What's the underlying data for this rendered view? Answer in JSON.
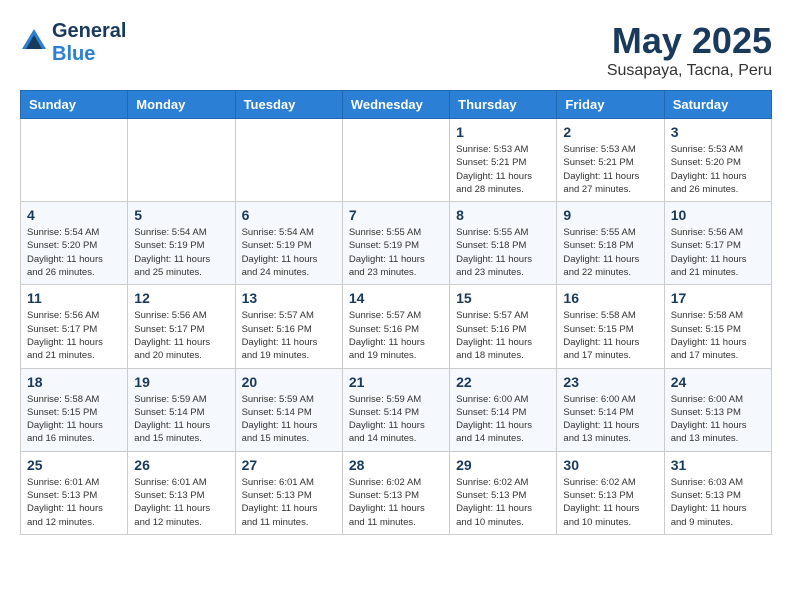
{
  "logo": {
    "general": "General",
    "blue": "Blue"
  },
  "title": {
    "month_year": "May 2025",
    "location": "Susapaya, Tacna, Peru"
  },
  "headers": [
    "Sunday",
    "Monday",
    "Tuesday",
    "Wednesday",
    "Thursday",
    "Friday",
    "Saturday"
  ],
  "weeks": [
    [
      {
        "day": "",
        "detail": ""
      },
      {
        "day": "",
        "detail": ""
      },
      {
        "day": "",
        "detail": ""
      },
      {
        "day": "",
        "detail": ""
      },
      {
        "day": "1",
        "detail": "Sunrise: 5:53 AM\nSunset: 5:21 PM\nDaylight: 11 hours\nand 28 minutes."
      },
      {
        "day": "2",
        "detail": "Sunrise: 5:53 AM\nSunset: 5:21 PM\nDaylight: 11 hours\nand 27 minutes."
      },
      {
        "day": "3",
        "detail": "Sunrise: 5:53 AM\nSunset: 5:20 PM\nDaylight: 11 hours\nand 26 minutes."
      }
    ],
    [
      {
        "day": "4",
        "detail": "Sunrise: 5:54 AM\nSunset: 5:20 PM\nDaylight: 11 hours\nand 26 minutes."
      },
      {
        "day": "5",
        "detail": "Sunrise: 5:54 AM\nSunset: 5:19 PM\nDaylight: 11 hours\nand 25 minutes."
      },
      {
        "day": "6",
        "detail": "Sunrise: 5:54 AM\nSunset: 5:19 PM\nDaylight: 11 hours\nand 24 minutes."
      },
      {
        "day": "7",
        "detail": "Sunrise: 5:55 AM\nSunset: 5:19 PM\nDaylight: 11 hours\nand 23 minutes."
      },
      {
        "day": "8",
        "detail": "Sunrise: 5:55 AM\nSunset: 5:18 PM\nDaylight: 11 hours\nand 23 minutes."
      },
      {
        "day": "9",
        "detail": "Sunrise: 5:55 AM\nSunset: 5:18 PM\nDaylight: 11 hours\nand 22 minutes."
      },
      {
        "day": "10",
        "detail": "Sunrise: 5:56 AM\nSunset: 5:17 PM\nDaylight: 11 hours\nand 21 minutes."
      }
    ],
    [
      {
        "day": "11",
        "detail": "Sunrise: 5:56 AM\nSunset: 5:17 PM\nDaylight: 11 hours\nand 21 minutes."
      },
      {
        "day": "12",
        "detail": "Sunrise: 5:56 AM\nSunset: 5:17 PM\nDaylight: 11 hours\nand 20 minutes."
      },
      {
        "day": "13",
        "detail": "Sunrise: 5:57 AM\nSunset: 5:16 PM\nDaylight: 11 hours\nand 19 minutes."
      },
      {
        "day": "14",
        "detail": "Sunrise: 5:57 AM\nSunset: 5:16 PM\nDaylight: 11 hours\nand 19 minutes."
      },
      {
        "day": "15",
        "detail": "Sunrise: 5:57 AM\nSunset: 5:16 PM\nDaylight: 11 hours\nand 18 minutes."
      },
      {
        "day": "16",
        "detail": "Sunrise: 5:58 AM\nSunset: 5:15 PM\nDaylight: 11 hours\nand 17 minutes."
      },
      {
        "day": "17",
        "detail": "Sunrise: 5:58 AM\nSunset: 5:15 PM\nDaylight: 11 hours\nand 17 minutes."
      }
    ],
    [
      {
        "day": "18",
        "detail": "Sunrise: 5:58 AM\nSunset: 5:15 PM\nDaylight: 11 hours\nand 16 minutes."
      },
      {
        "day": "19",
        "detail": "Sunrise: 5:59 AM\nSunset: 5:14 PM\nDaylight: 11 hours\nand 15 minutes."
      },
      {
        "day": "20",
        "detail": "Sunrise: 5:59 AM\nSunset: 5:14 PM\nDaylight: 11 hours\nand 15 minutes."
      },
      {
        "day": "21",
        "detail": "Sunrise: 5:59 AM\nSunset: 5:14 PM\nDaylight: 11 hours\nand 14 minutes."
      },
      {
        "day": "22",
        "detail": "Sunrise: 6:00 AM\nSunset: 5:14 PM\nDaylight: 11 hours\nand 14 minutes."
      },
      {
        "day": "23",
        "detail": "Sunrise: 6:00 AM\nSunset: 5:14 PM\nDaylight: 11 hours\nand 13 minutes."
      },
      {
        "day": "24",
        "detail": "Sunrise: 6:00 AM\nSunset: 5:13 PM\nDaylight: 11 hours\nand 13 minutes."
      }
    ],
    [
      {
        "day": "25",
        "detail": "Sunrise: 6:01 AM\nSunset: 5:13 PM\nDaylight: 11 hours\nand 12 minutes."
      },
      {
        "day": "26",
        "detail": "Sunrise: 6:01 AM\nSunset: 5:13 PM\nDaylight: 11 hours\nand 12 minutes."
      },
      {
        "day": "27",
        "detail": "Sunrise: 6:01 AM\nSunset: 5:13 PM\nDaylight: 11 hours\nand 11 minutes."
      },
      {
        "day": "28",
        "detail": "Sunrise: 6:02 AM\nSunset: 5:13 PM\nDaylight: 11 hours\nand 11 minutes."
      },
      {
        "day": "29",
        "detail": "Sunrise: 6:02 AM\nSunset: 5:13 PM\nDaylight: 11 hours\nand 10 minutes."
      },
      {
        "day": "30",
        "detail": "Sunrise: 6:02 AM\nSunset: 5:13 PM\nDaylight: 11 hours\nand 10 minutes."
      },
      {
        "day": "31",
        "detail": "Sunrise: 6:03 AM\nSunset: 5:13 PM\nDaylight: 11 hours\nand 9 minutes."
      }
    ]
  ]
}
